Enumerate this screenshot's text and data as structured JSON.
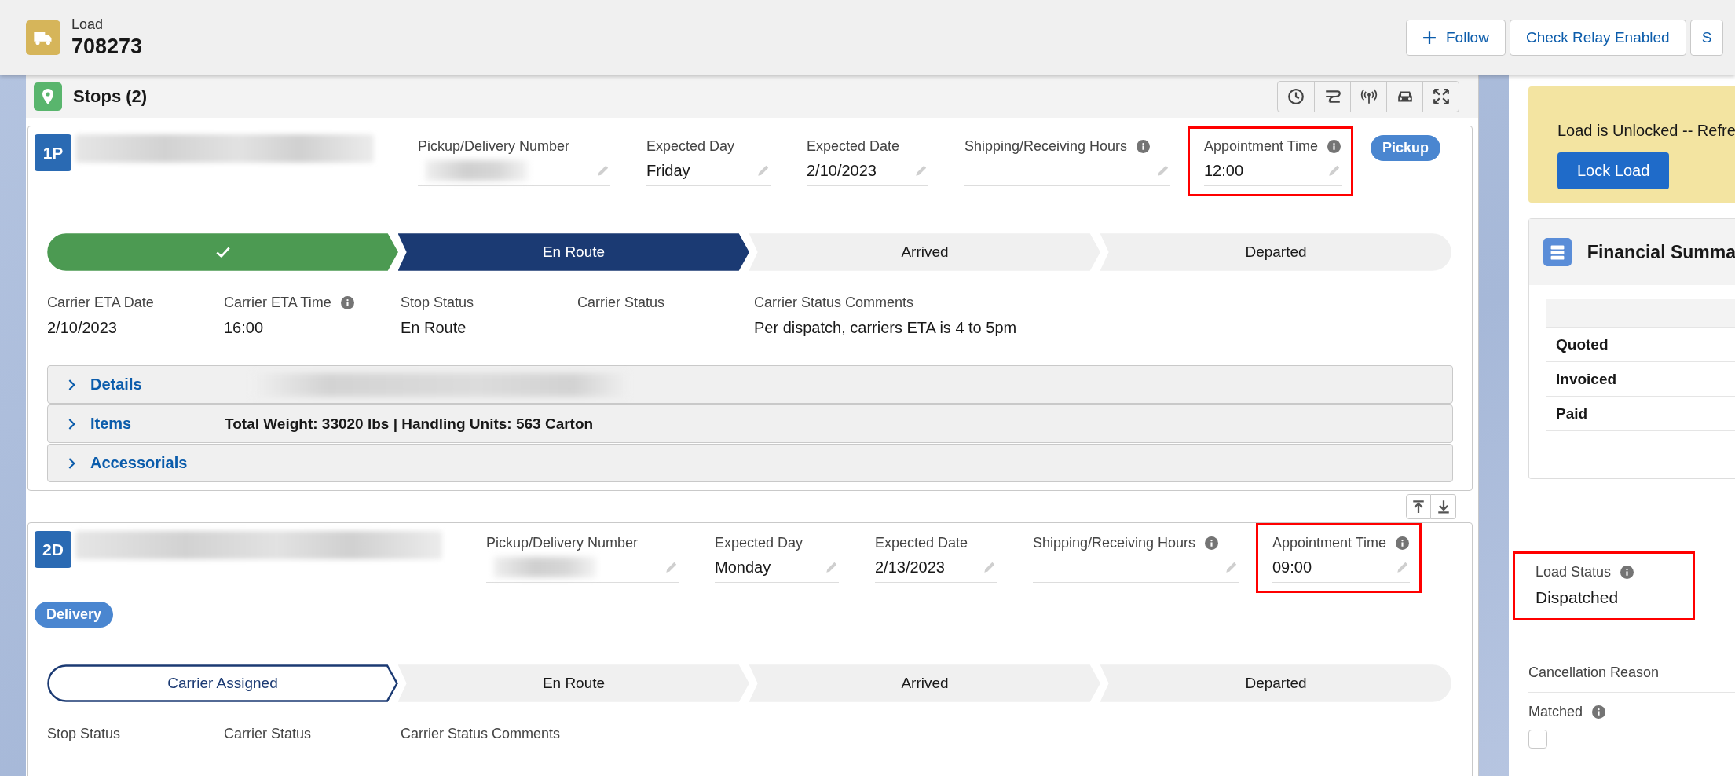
{
  "header": {
    "object_label": "Load",
    "record_name": "708273",
    "actions": [
      {
        "label": "Follow",
        "kind": "follow"
      },
      {
        "label": "Check Relay Enabled",
        "kind": "plain"
      },
      {
        "label": "S",
        "kind": "plain"
      }
    ]
  },
  "stops_card": {
    "title": "Stops (2)"
  },
  "stops": [
    {
      "badge": "1P",
      "type": "Pickup",
      "fields": [
        {
          "label": "Pickup/Delivery Number",
          "redacted": true,
          "info": false,
          "highlighted": false
        },
        {
          "label": "Expected Day",
          "value": "Friday",
          "redacted": false,
          "info": false,
          "highlighted": false
        },
        {
          "label": "Expected Date",
          "value": "2/10/2023",
          "redacted": false,
          "info": false,
          "highlighted": false
        },
        {
          "label": "Shipping/Receiving Hours",
          "redacted": false,
          "info": true,
          "highlighted": false
        },
        {
          "label": "Appointment Time",
          "value": "12:00",
          "redacted": false,
          "info": true,
          "highlighted": true
        }
      ],
      "path": [
        {
          "complete": true,
          "current": false,
          "selected": false
        },
        {
          "label": "En Route",
          "complete": false,
          "current": true,
          "selected": true
        },
        {
          "label": "Arrived",
          "complete": false,
          "current": false,
          "selected": false
        },
        {
          "label": "Departed",
          "complete": false,
          "current": false,
          "selected": false
        }
      ],
      "status_fields": [
        {
          "label": "Carrier ETA Date",
          "value": "2/10/2023",
          "info": false
        },
        {
          "label": "Carrier ETA Time",
          "value": "16:00",
          "info": true
        },
        {
          "label": "Stop Status",
          "value": "En Route",
          "info": false
        },
        {
          "label": "Carrier Status",
          "info": false
        },
        {
          "label": "Carrier Status Comments",
          "value": "Per dispatch, carriers ETA is 4 to 5pm",
          "info": false
        }
      ],
      "sections": [
        {
          "title": "Details",
          "expanded": false,
          "redacted": true
        },
        {
          "title": "Items",
          "expanded": false,
          "redacted": false,
          "summary": "Total Weight: 33020 lbs | Handling Units: 563 Carton"
        },
        {
          "title": "Accessorials",
          "expanded": false,
          "redacted": false
        }
      ]
    },
    {
      "badge": "2D",
      "type": "Delivery",
      "fields": [
        {
          "label": "Pickup/Delivery Number",
          "redacted": true,
          "info": false,
          "highlighted": false
        },
        {
          "label": "Expected Day",
          "value": "Monday",
          "redacted": false,
          "info": false,
          "highlighted": false
        },
        {
          "label": "Expected Date",
          "value": "2/13/2023",
          "redacted": false,
          "info": false,
          "highlighted": false
        },
        {
          "label": "Shipping/Receiving Hours",
          "redacted": false,
          "info": true,
          "highlighted": false
        },
        {
          "label": "Appointment Time",
          "value": "09:00",
          "redacted": false,
          "info": true,
          "highlighted": true
        }
      ],
      "path": [
        {
          "label": "Carrier Assigned",
          "complete": false,
          "current": true,
          "selected": false
        },
        {
          "label": "En Route",
          "complete": false,
          "current": false,
          "selected": false
        },
        {
          "label": "Arrived",
          "complete": false,
          "current": false,
          "selected": false
        },
        {
          "label": "Departed",
          "complete": false,
          "current": false,
          "selected": false
        }
      ],
      "status_fields": [
        {
          "label": "Stop Status",
          "info": false
        },
        {
          "label": "Carrier Status",
          "info": false
        },
        {
          "label": "Carrier Status Comments",
          "info": false
        }
      ]
    }
  ],
  "lock_banner": {
    "message": "Load is Unlocked -- Refre",
    "button": "Lock Load"
  },
  "financial_summary": {
    "title": "Financial Summa",
    "rows": [
      "Quoted",
      "Invoiced",
      "Paid"
    ]
  },
  "load_fields": [
    {
      "kind": "text",
      "label": "Load Status",
      "value": "Dispatched",
      "info": true,
      "highlighted": true
    },
    {
      "kind": "text",
      "label": "Cancellation Reason",
      "info": false,
      "highlighted": false
    },
    {
      "kind": "checkbox",
      "label": "Matched",
      "info": true,
      "checked": false,
      "highlighted": false
    }
  ]
}
